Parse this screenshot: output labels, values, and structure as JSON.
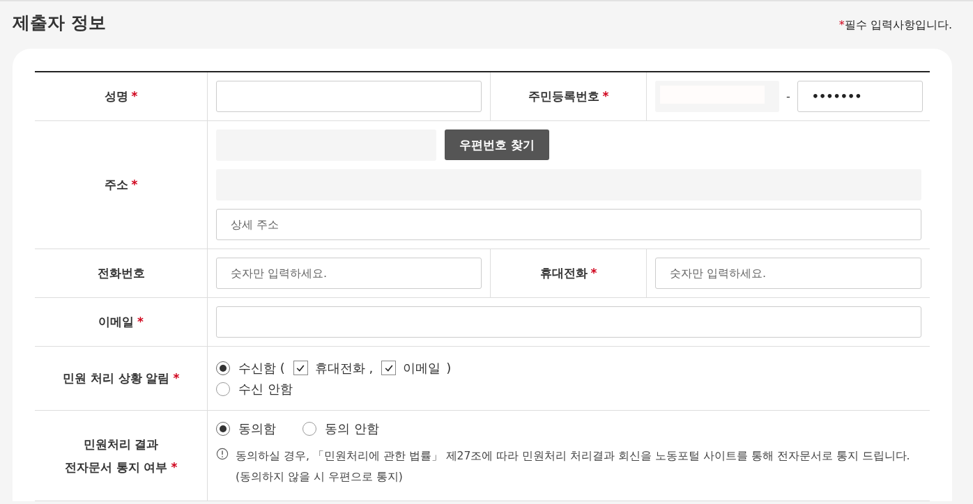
{
  "title": "제출자 정보",
  "required_note": {
    "mark": "*",
    "text": "필수 입력사항입니다."
  },
  "rows": [
    {
      "kind": "pair",
      "fields": [
        {
          "label": "성명",
          "mark": "*",
          "input": {
            "kind": "text"
          }
        },
        {
          "label": "주민등록번호",
          "mark": "*",
          "input": {
            "kind": "rrn",
            "separator": "-",
            "value": "•••••••"
          }
        }
      ]
    },
    {
      "kind": "address",
      "label": "주소",
      "mark": "*",
      "button": "우편번호 찾기",
      "detail_placeholder": "상세 주소"
    },
    {
      "kind": "pair",
      "fields": [
        {
          "label": "전화번호",
          "input": {
            "kind": "text",
            "placeholder": "숫자만 입력하세요."
          }
        },
        {
          "label": "휴대전화",
          "mark": "*",
          "input": {
            "kind": "text",
            "placeholder": "숫자만 입력하세요."
          }
        }
      ]
    },
    {
      "kind": "single",
      "label": "이메일",
      "mark": "*",
      "input": {
        "kind": "text"
      }
    },
    {
      "kind": "notify",
      "label": "민원 처리 상황 알림",
      "mark": "*",
      "options": [
        {
          "label": "수신함 (",
          "selected": true,
          "channels": [
            {
              "label": "휴대전화 ,",
              "checked": true
            },
            {
              "label": "이메일",
              "checked": true
            }
          ],
          "close": ")"
        },
        {
          "label": "수신 안함",
          "selected": false
        }
      ]
    },
    {
      "kind": "consent",
      "label": "민원처리 결과\n전자문서 통지 여부",
      "mark": "*",
      "options": [
        {
          "label": "동의함",
          "selected": true
        },
        {
          "label": "동의 안함",
          "selected": false
        }
      ],
      "notice": [
        "동의하실 경우, 「민원처리에 관한 법률」 제27조에 따라 민원처리 처리결과 회신을 노동포털 사이트를 통해 전자문서로 통지 드립니다.",
        "(동의하지 않을 시 우편으로 통지)"
      ]
    }
  ]
}
